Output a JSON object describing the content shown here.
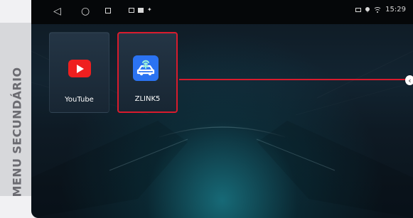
{
  "side_panel": {
    "label": "MENU SECUNDÁRIO"
  },
  "status_bar": {
    "nav_back_icon": "triangle-left-icon",
    "nav_home_icon": "circle-icon",
    "nav_recents_icon": "square-icon",
    "mini_icons": [
      "screen-mirror-icon",
      "message-icon",
      "signal-icon"
    ],
    "time": "15:29",
    "status_icons": [
      "battery-icon",
      "location-icon",
      "wifi-icon"
    ]
  },
  "apps": [
    {
      "label": "YouTube",
      "icon": "youtube-icon",
      "accent": "#ef1f1f"
    },
    {
      "label": "ZLINK5",
      "icon": "zlink-icon",
      "accent": "#2b73f2",
      "selected": true
    }
  ],
  "colors": {
    "highlight": "#d91b2d",
    "page_background": "#f1f1f3",
    "side_panel": "#d7d8db",
    "screen_dark": "#0f1922",
    "teal_glow": "#1e9eae"
  }
}
